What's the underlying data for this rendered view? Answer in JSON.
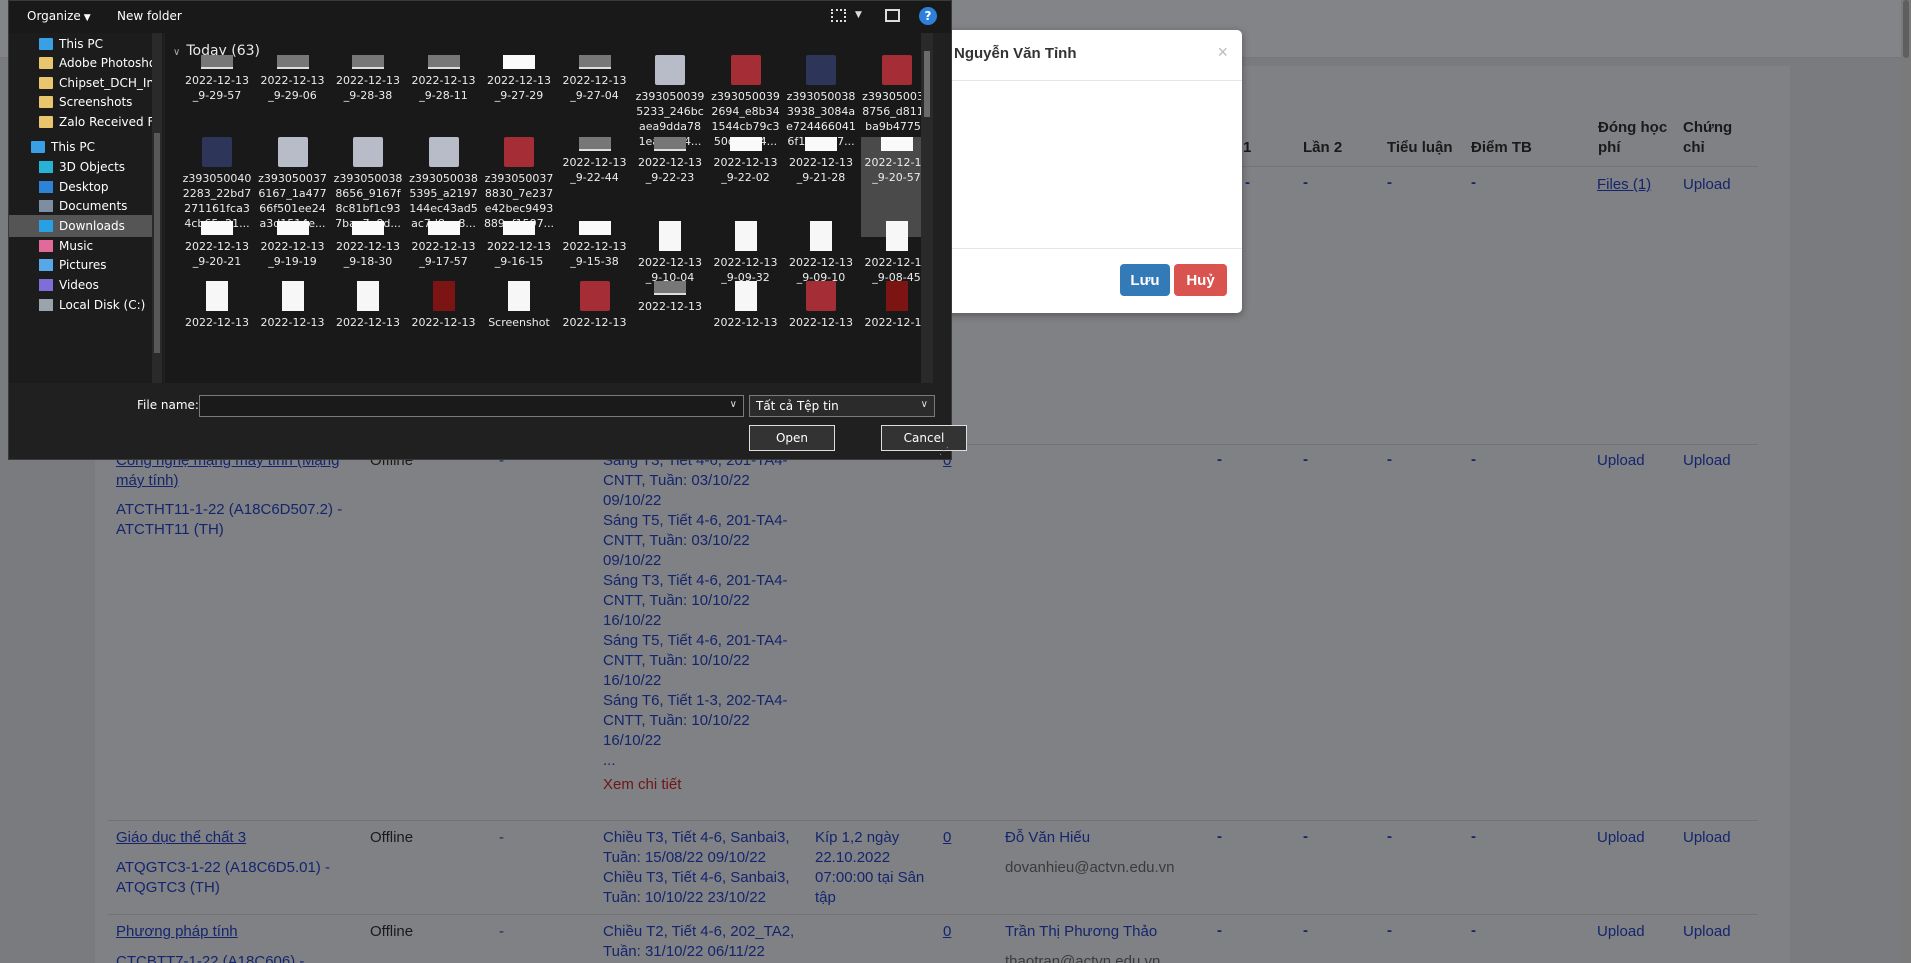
{
  "table": {
    "headers": {
      "lan1": "1",
      "lan2": "Lần 2",
      "tieu_luan": "Tiểu luận",
      "diem_tb": "Điểm TB",
      "dong_hoc_phi": "Đóng học phí",
      "chung_chi": "Chứng chỉ"
    },
    "row0": {
      "files": "Files (1)",
      "upload": "Upload"
    },
    "row1": {
      "course": "Công nghệ mạng máy tính (Mạng máy tính)",
      "class": "ATCTHT11-1-22 (A18C6D507.2) - ATCTHT11 (TH)",
      "mode": "Offline",
      "schedule": [
        "Sáng T3, Tiết 4-6, 201-TA4-",
        "CNTT, Tuần: 03/10/22",
        "09/10/22",
        "Sáng T5, Tiết 4-6, 201-TA4-",
        "CNTT, Tuần: 03/10/22",
        "09/10/22",
        "Sáng T3, Tiết 4-6, 201-TA4-",
        "CNTT, Tuần: 10/10/22",
        "16/10/22",
        "Sáng T5, Tiết 4-6, 201-TA4-",
        "CNTT, Tuần: 10/10/22",
        "16/10/22",
        "Sáng T6, Tiết 1-3, 202-TA4-",
        "CNTT, Tuần: 10/10/22",
        "16/10/22",
        "..."
      ],
      "detail": "Xem chi tiết",
      "count": "0",
      "upload1": "Upload",
      "upload2": "Upload"
    },
    "row2": {
      "course": "Giáo dục thể chất 3",
      "class": "ATQGTC3-1-22 (A18C6D5.01) - ATQGTC3 (TH)",
      "mode": "Offline",
      "schedule": [
        "Chiều T3, Tiết 4-6, Sanbai3,",
        "Tuần: 15/08/22 09/10/22",
        "Chiều T3, Tiết 4-6, Sanbai3,",
        "Tuần: 10/10/22 23/10/22"
      ],
      "exam": [
        "Kíp 1,2 ngày",
        "22.10.2022",
        "07:00:00 tại Sân",
        "tập"
      ],
      "count": "0",
      "teacher": "Đỗ Văn Hiếu",
      "email": "dovanhieu@actvn.edu.vn",
      "upload1": "Upload",
      "upload2": "Upload"
    },
    "row3": {
      "course": "Phương pháp tính",
      "class": "CTCBTT7-1-22 (A18C606) -",
      "mode": "Offline",
      "schedule": [
        "Chiều T2, Tiết 4-6, 202_TA2,",
        "Tuần: 31/10/22 06/11/22"
      ],
      "count": "0",
      "teacher": "Trần Thị Phương Thảo",
      "email": "thaotran@actvn.edu.vn",
      "upload1": "Upload",
      "upload2": "Upload"
    },
    "dash": "-"
  },
  "modal": {
    "title": "Nguyễn Văn Tỉnh",
    "close": "×",
    "save": "Lưu",
    "cancel": "Huỷ"
  },
  "dialog": {
    "toolbar": {
      "organize": "Organize",
      "new_folder": "New folder",
      "help": "?"
    },
    "nav": [
      {
        "label": "This PC",
        "icon": "pc-icon",
        "pinned": true
      },
      {
        "label": "Adobe Photoshop",
        "icon": "folder-icon"
      },
      {
        "label": "Chipset_DCH_Intel",
        "icon": "folder-icon"
      },
      {
        "label": "Screenshots",
        "icon": "folder-icon"
      },
      {
        "label": "Zalo Received Files",
        "icon": "folder-icon"
      },
      {
        "label": "This PC",
        "icon": "pc-icon"
      },
      {
        "label": "3D Objects",
        "icon": "cube-icon"
      },
      {
        "label": "Desktop",
        "icon": "desktop-icon"
      },
      {
        "label": "Documents",
        "icon": "documents-icon"
      },
      {
        "label": "Downloads",
        "icon": "downloads-icon",
        "selected": true
      },
      {
        "label": "Music",
        "icon": "music-icon"
      },
      {
        "label": "Pictures",
        "icon": "pictures-icon"
      },
      {
        "label": "Videos",
        "icon": "videos-icon"
      },
      {
        "label": "Local Disk (C:)",
        "icon": "disk-icon"
      }
    ],
    "group": "Today (63)",
    "rows": [
      [
        {
          "l1": "2022-12-13",
          "l2": "_9-29-57",
          "t": "dark"
        },
        {
          "l1": "2022-12-13",
          "l2": "_9-29-06",
          "t": "dark"
        },
        {
          "l1": "2022-12-13",
          "l2": "_9-28-38",
          "t": "dark"
        },
        {
          "l1": "2022-12-13",
          "l2": "_9-28-11",
          "t": "dark"
        },
        {
          "l1": "2022-12-13",
          "l2": "_9-27-29",
          "t": "white"
        },
        {
          "l1": "2022-12-13",
          "l2": "_9-27-04",
          "t": "dark"
        },
        {
          "l1": "z393050039",
          "l2": "5233_246bc",
          "l3": "aea9dda78",
          "l4": "1eaf5854...",
          "t": "photo"
        },
        {
          "l1": "z393050039",
          "l2": "2694_e8b34",
          "l3": "1544cb79c3",
          "l4": "50d64f04...",
          "t": "red"
        },
        {
          "l1": "z393050038",
          "l2": "3938_3084a",
          "l3": "e724466041",
          "l4": "6f1f596d7...",
          "t": "navy"
        },
        {
          "l1": "z393050039",
          "l2": "8756_d8110",
          "l3": "ba9b47751",
          "l4": "def79dac...",
          "t": "red"
        }
      ],
      [
        {
          "l1": "z393050040",
          "l2": "2283_22bd7",
          "l3": "271161fca3",
          "l4": "4cb65e21...",
          "t": "navy"
        },
        {
          "l1": "z393050037",
          "l2": "6167_1a477",
          "l3": "66f501ee24",
          "l4": "a3d1514e...",
          "t": "photo"
        },
        {
          "l1": "z393050038",
          "l2": "8656_9167f",
          "l3": "8c81bf1c93",
          "l4": "7baa7e8d...",
          "t": "photo"
        },
        {
          "l1": "z393050038",
          "l2": "5395_a2197",
          "l3": "144ec43ad5",
          "l4": "ac7d8aa8...",
          "t": "photo"
        },
        {
          "l1": "z393050037",
          "l2": "8830_7e237",
          "l3": "e42bec9493",
          "l4": "889ef1597...",
          "t": "red"
        },
        {
          "l1": "2022-12-13",
          "l2": "_9-22-44",
          "t": "dark"
        },
        {
          "l1": "2022-12-13",
          "l2": "_9-22-23",
          "t": "dark"
        },
        {
          "l1": "2022-12-13",
          "l2": "_9-22-02",
          "t": "white"
        },
        {
          "l1": "2022-12-13",
          "l2": "_9-21-28",
          "t": "white"
        },
        {
          "l1": "2022-12-13",
          "l2": "_9-20-57",
          "t": "white",
          "selected": true
        }
      ],
      [
        {
          "l1": "2022-12-13",
          "l2": "_9-20-21",
          "t": "white"
        },
        {
          "l1": "2022-12-13",
          "l2": "_9-19-19",
          "t": "white"
        },
        {
          "l1": "2022-12-13",
          "l2": "_9-18-30",
          "t": "white"
        },
        {
          "l1": "2022-12-13",
          "l2": "_9-17-57",
          "t": "white"
        },
        {
          "l1": "2022-12-13",
          "l2": "_9-16-15",
          "t": "white"
        },
        {
          "l1": "2022-12-13",
          "l2": "_9-15-38",
          "t": "white"
        },
        {
          "l1": "2022-12-13",
          "l2": "_9-10-04",
          "t": "doc"
        },
        {
          "l1": "2022-12-13",
          "l2": "_9-09-32",
          "t": "doc"
        },
        {
          "l1": "2022-12-13",
          "l2": "_9-09-10",
          "t": "doc"
        },
        {
          "l1": "2022-12-13",
          "l2": "_9-08-45",
          "t": "doc"
        }
      ],
      [
        {
          "l1": "2022-12-13",
          "t": "doc"
        },
        {
          "l1": "2022-12-13",
          "t": "doc"
        },
        {
          "l1": "2022-12-13",
          "t": "doc"
        },
        {
          "l1": "2022-12-13",
          "t": "maroon"
        },
        {
          "l1": "Screenshot",
          "t": "doc"
        },
        {
          "l1": "2022-12-13",
          "t": "red"
        },
        {
          "l1": "2022-12-13",
          "t": "dark"
        },
        {
          "l1": "2022-12-13",
          "t": "doc"
        },
        {
          "l1": "2022-12-13",
          "t": "red"
        },
        {
          "l1": "2022-12-13",
          "t": "maroon"
        }
      ]
    ],
    "file_name_label": "File name:",
    "file_name_value": "",
    "file_type": "Tất cả Tệp tin",
    "open": "Open",
    "cancel": "Cancel"
  }
}
